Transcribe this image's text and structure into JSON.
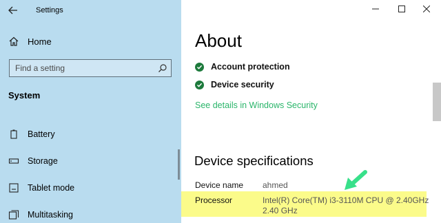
{
  "window": {
    "app_title": "Settings"
  },
  "sidebar": {
    "home_label": "Home",
    "search": {
      "placeholder": "Find a setting"
    },
    "section_label": "System",
    "items": [
      {
        "label": "Battery",
        "icon": "battery-icon"
      },
      {
        "label": "Storage",
        "icon": "storage-icon"
      },
      {
        "label": "Tablet mode",
        "icon": "tablet-icon"
      },
      {
        "label": "Multitasking",
        "icon": "multitasking-icon"
      }
    ]
  },
  "main": {
    "title": "About",
    "protection": [
      {
        "label": "Account protection",
        "icon": "check-circle-icon"
      },
      {
        "label": "Device security",
        "icon": "check-circle-icon"
      }
    ],
    "security_link": "See details in Windows Security",
    "specs_title": "Device specifications",
    "specs": [
      {
        "label": "Device name",
        "value": "ahmed"
      },
      {
        "label": "Processor",
        "value": "Intel(R) Core(TM) i3-3110M CPU @ 2.40GHz",
        "value2": "2.40 GHz"
      }
    ]
  },
  "colors": {
    "sidebar_bg": "#b9dcef",
    "link": "#2ab56a",
    "highlight": "#fbfb8a",
    "check": "#1d7a3c",
    "arrow": "#38e08a"
  }
}
